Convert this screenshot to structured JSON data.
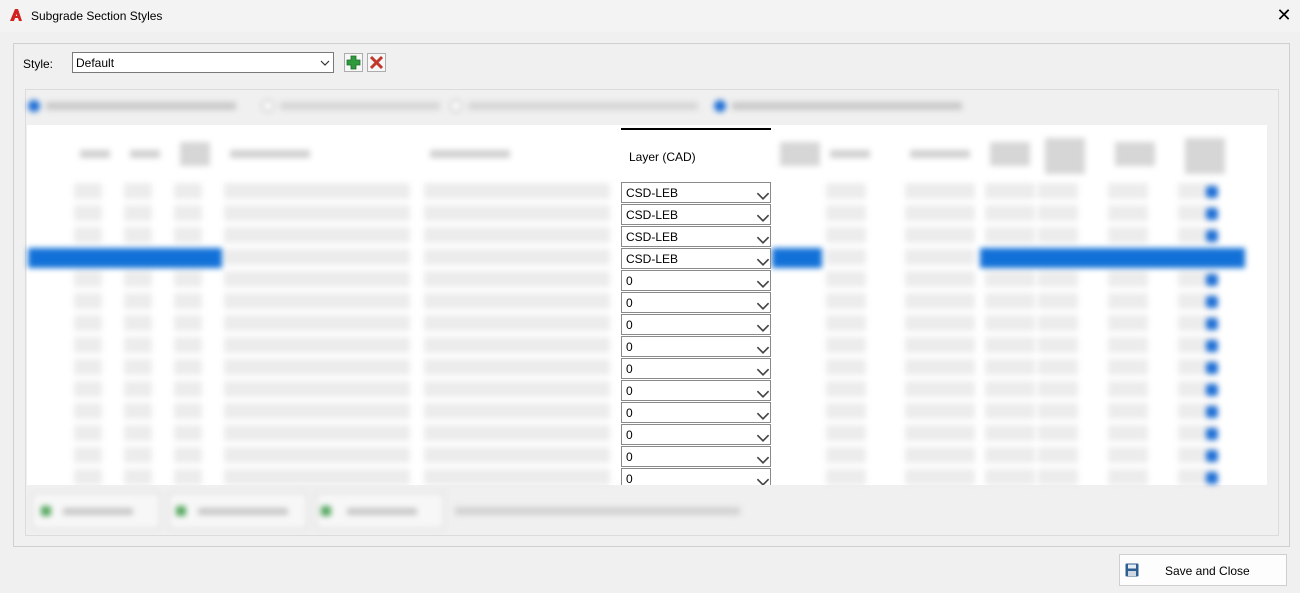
{
  "window": {
    "title": "Subgrade Section Styles",
    "close_glyph": "✕"
  },
  "style": {
    "label": "Style:",
    "selected": "Default"
  },
  "grid": {
    "focused_column_header": "Layer (CAD)",
    "layer_values": [
      "CSD-LEB",
      "CSD-LEB",
      "CSD-LEB",
      "CSD-LEB",
      "0",
      "0",
      "0",
      "0",
      "0",
      "0",
      "0",
      "0",
      "0",
      "0"
    ],
    "selected_row_index": 3
  },
  "footer": {
    "save_label": "Save and Close"
  },
  "colors": {
    "accent": "#1271d8",
    "add_green": "#2e9a3b",
    "delete_red": "#c0392b"
  },
  "icons": [
    "autocad-icon",
    "close-icon",
    "add-icon",
    "delete-icon",
    "chevron-down-icon",
    "save-icon"
  ]
}
